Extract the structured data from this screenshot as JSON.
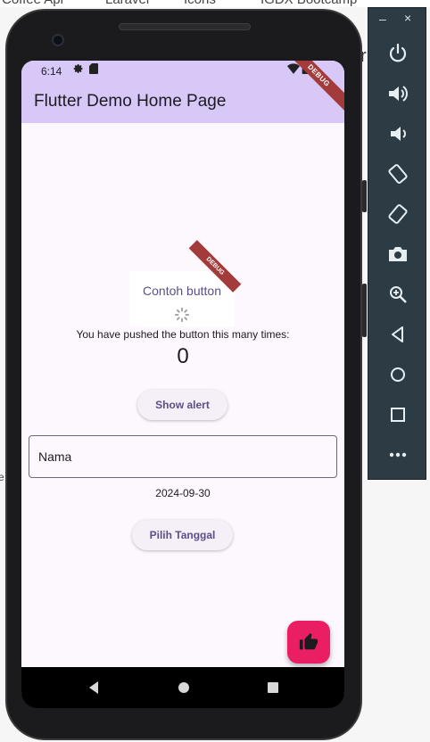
{
  "background": {
    "bookmarks": [
      "Coffee Api",
      "Laravel",
      "Icons",
      "IGDX Bootcamp"
    ],
    "edge_letter": "r",
    "left_glyph": "e"
  },
  "status_bar": {
    "time": "6:14"
  },
  "app_bar": {
    "title": "Flutter Demo Home Page"
  },
  "debug_banner": {
    "label": "DEBUG"
  },
  "inner_widget": {
    "button_label": "Contoh button",
    "debug_label": "DEBUG"
  },
  "counter": {
    "label": "You have pushed the button this many times:",
    "value": "0"
  },
  "alert_button": {
    "label": "Show alert"
  },
  "name_field": {
    "value": "Nama"
  },
  "date": {
    "value": "2024-09-30"
  },
  "date_button": {
    "label": "Pilih Tanggal"
  },
  "fab": {
    "icon": "thumb-up-icon",
    "color": "#e91e63"
  },
  "colors": {
    "app_bar": "#d7c8f8",
    "accent": "#5b4e8a",
    "surface": "#fdf7fe"
  },
  "emulator_toolbar": {
    "minimize": "–",
    "close": "×",
    "buttons": [
      "power-icon",
      "volume-up-icon",
      "volume-down-icon",
      "rotate-left-icon",
      "rotate-right-icon",
      "camera-icon",
      "zoom-icon",
      "back-icon",
      "home-icon",
      "overview-icon",
      "more-icon"
    ]
  }
}
